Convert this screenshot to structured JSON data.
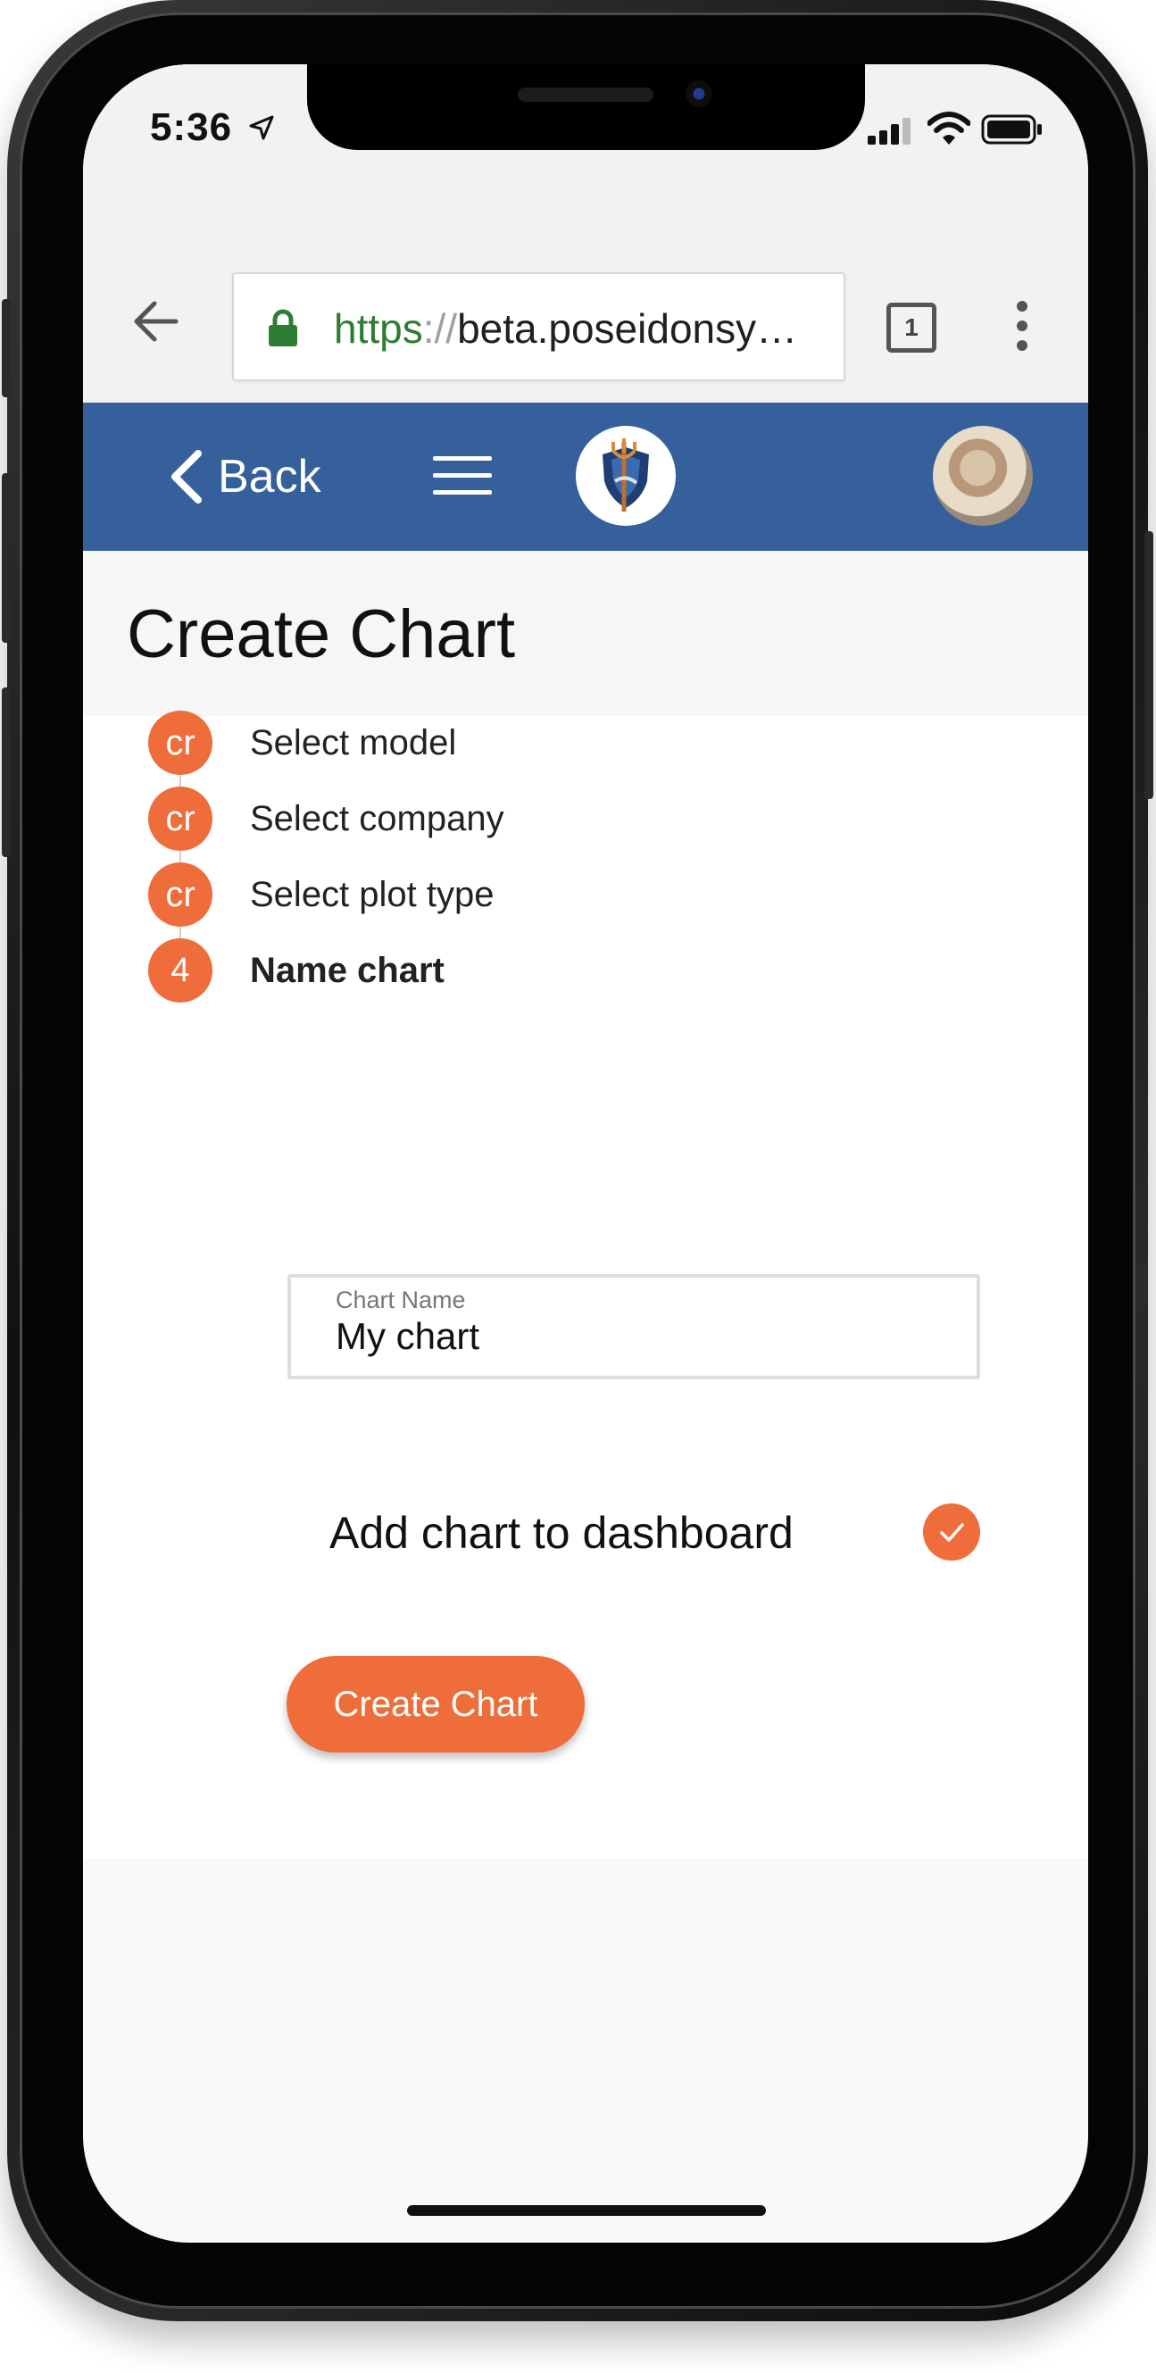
{
  "status_bar": {
    "time": "5:36"
  },
  "browser": {
    "url_scheme": "https",
    "url_separator": "://",
    "url_host": "beta.poseidonsy…",
    "tab_count": "1"
  },
  "header": {
    "back_label": "Back"
  },
  "page": {
    "title": "Create Chart"
  },
  "steps": [
    {
      "badge": "cr",
      "label": "Select model"
    },
    {
      "badge": "cr",
      "label": "Select company"
    },
    {
      "badge": "cr",
      "label": "Select plot type"
    },
    {
      "badge": "4",
      "label": "Name chart"
    }
  ],
  "form": {
    "chart_name_label": "Chart Name",
    "chart_name_value": "My chart",
    "dashboard_label": "Add chart to dashboard",
    "dashboard_checked": true,
    "submit_label": "Create Chart"
  },
  "colors": {
    "accent": "#ee6d3a",
    "header": "#35609c",
    "url_secure": "#2e7d32"
  },
  "icons": {
    "browser_back": "arrow-left-icon",
    "lock": "lock-icon",
    "menu": "hamburger-menu-icon",
    "kebab": "more-vert-icon",
    "check": "checkmark-icon"
  }
}
